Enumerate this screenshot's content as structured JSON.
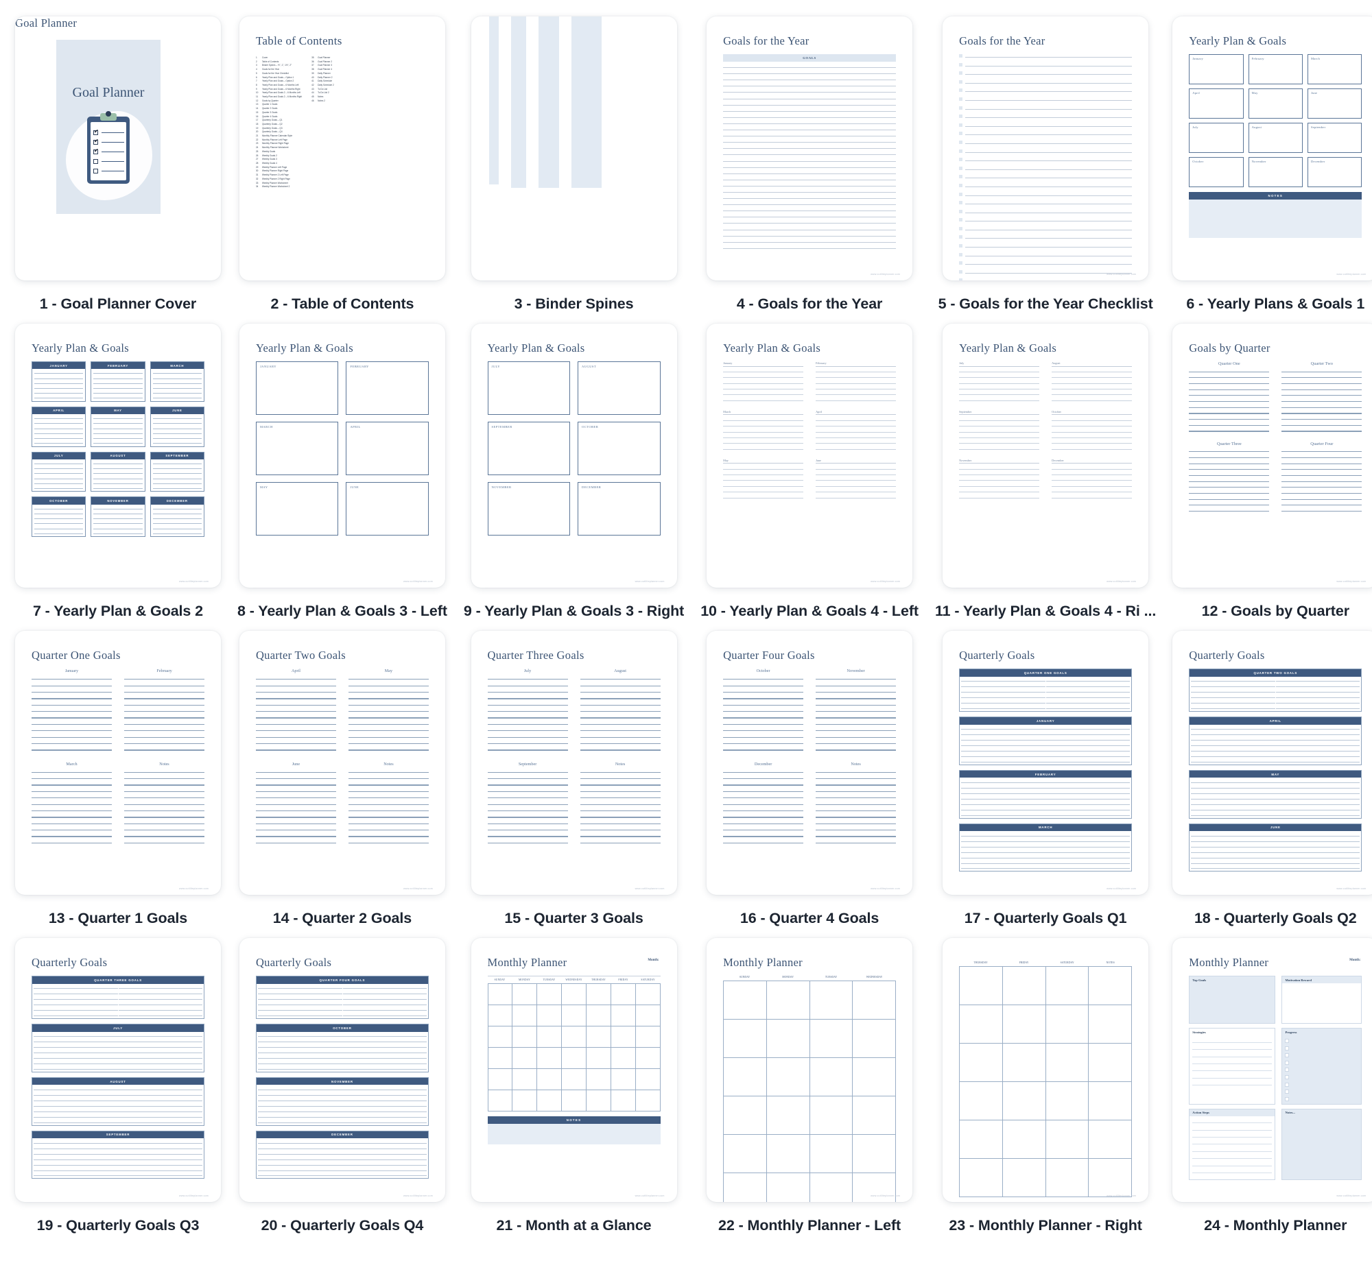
{
  "theme": {
    "accent_dark": "#3f5a80",
    "accent_light": "#dfe7f0",
    "title_color": "#3c5474",
    "page_bg": "#ffffff"
  },
  "cards": [
    {
      "n": 1,
      "caption": "1 - Goal Planner Cover",
      "type": "cover",
      "title": "Goal Planner"
    },
    {
      "n": 2,
      "caption": "2 - Table of Contents",
      "type": "toc",
      "title": "Table of Contents"
    },
    {
      "n": 3,
      "caption": "3 - Binder Spines",
      "type": "spines"
    },
    {
      "n": 4,
      "caption": "4 - Goals for the Year",
      "type": "lines",
      "title": "Goals for the Year",
      "header": "GOALS"
    },
    {
      "n": 5,
      "caption": "5 - Goals for the Year Checklist",
      "type": "checklist",
      "title": "Goals for the Year"
    },
    {
      "n": 6,
      "caption": "6 - Yearly Plans & Goals 1",
      "type": "monthbox",
      "title": "Yearly Plan & Goals",
      "notes": "NOTES"
    },
    {
      "n": 7,
      "caption": "7 - Yearly Plan & Goals 2",
      "type": "monthbar",
      "title": "Yearly Plan & Goals"
    },
    {
      "n": 8,
      "caption": "8 - Yearly Plan & Goals 3 - Left",
      "type": "bigbox",
      "title": "Yearly Plan & Goals",
      "months": [
        "JANUARY",
        "FEBRUARY",
        "MARCH",
        "APRIL",
        "MAY",
        "JUNE"
      ]
    },
    {
      "n": 9,
      "caption": "9 - Yearly Plan & Goals 3 - Right",
      "type": "bigbox",
      "title": "Yearly Plan & Goals",
      "months": [
        "JULY",
        "AUGUST",
        "SEPTEMBER",
        "OCTOBER",
        "NOVEMBER",
        "DECEMBER"
      ]
    },
    {
      "n": 10,
      "caption": "10 - Yearly Plan & Goals 4 - Left",
      "type": "labeled",
      "title": "Yearly Plan & Goals",
      "months": [
        "January",
        "February",
        "March",
        "April",
        "May",
        "June"
      ]
    },
    {
      "n": 11,
      "caption": "11 - Yearly Plan & Goals 4 - Ri  ...",
      "type": "labeled",
      "title": "Yearly Plan & Goals",
      "months": [
        "July",
        "August",
        "September",
        "October",
        "November",
        "December"
      ]
    },
    {
      "n": 12,
      "caption": "12 - Goals by Quarter",
      "type": "quarters",
      "title": "Goals by Quarter",
      "quarters": [
        "Quarter One",
        "Quarter Two",
        "Quarter Three",
        "Quarter Four"
      ]
    },
    {
      "n": 13,
      "caption": "13 - Quarter 1 Goals",
      "type": "qgoals",
      "title": "Quarter One Goals",
      "cells": [
        "January",
        "February",
        "March",
        "Notes"
      ]
    },
    {
      "n": 14,
      "caption": "14 - Quarter 2 Goals",
      "type": "qgoals",
      "title": "Quarter Two Goals",
      "cells": [
        "April",
        "May",
        "June",
        "Notes"
      ]
    },
    {
      "n": 15,
      "caption": "15 - Quarter 3 Goals",
      "type": "qgoals",
      "title": "Quarter Three Goals",
      "cells": [
        "July",
        "August",
        "September",
        "Notes"
      ]
    },
    {
      "n": 16,
      "caption": "16 - Quarter 4 Goals",
      "type": "qgoals",
      "title": "Quarter Four Goals",
      "cells": [
        "October",
        "November",
        "December",
        "Notes"
      ]
    },
    {
      "n": 17,
      "caption": "17 - Quarterly Goals Q1",
      "type": "banded",
      "title": "Quarterly Goals",
      "bands": [
        "QUARTER ONE GOALS",
        "JANUARY",
        "FEBRUARY",
        "MARCH"
      ]
    },
    {
      "n": 18,
      "caption": "18 - Quarterly Goals Q2",
      "type": "banded",
      "title": "Quarterly Goals",
      "bands": [
        "QUARTER TWO GOALS",
        "APRIL",
        "MAY",
        "JUNE"
      ]
    },
    {
      "n": 19,
      "caption": "19 - Quarterly Goals Q3",
      "type": "banded",
      "title": "Quarterly Goals",
      "bands": [
        "QUARTER THREE GOALS",
        "JULY",
        "AUGUST",
        "SEPTEMBER"
      ]
    },
    {
      "n": 20,
      "caption": "20 - Quarterly Goals Q4",
      "type": "banded",
      "title": "Quarterly Goals",
      "bands": [
        "QUARTER FOUR GOALS",
        "OCTOBER",
        "NOVEMBER",
        "DECEMBER"
      ]
    },
    {
      "n": 21,
      "caption": "21 - Month at a Glance",
      "type": "calendar",
      "title": "Monthly Planner",
      "month_label": "Month:",
      "notes": "NOTES",
      "dow": [
        "SUNDAY",
        "MONDAY",
        "TUESDAY",
        "WEDNESDAY",
        "THURSDAY",
        "FRIDAY",
        "SATURDAY"
      ]
    },
    {
      "n": 22,
      "caption": "22 - Monthly Planner - Left",
      "type": "halfcal",
      "title": "Monthly Planner",
      "dow": [
        "SUNDAY",
        "MONDAY",
        "TUESDAY",
        "WEDNESDAY"
      ]
    },
    {
      "n": 23,
      "caption": "23 - Monthly Planner - Right",
      "type": "halfcal",
      "title": "",
      "dow": [
        "THURSDAY",
        "FRIDAY",
        "SATURDAY",
        "NOTES"
      ]
    },
    {
      "n": 24,
      "caption": "24 - Monthly Planner",
      "type": "worksheet",
      "title": "Monthly Planner",
      "month_label": "Month:",
      "sections": {
        "top_goals": "Top Goals",
        "strategies": "Strategies",
        "action_steps": "Action Steps",
        "motivation": "Motivation Reward",
        "progress": "Progress",
        "notes": "Notes..."
      }
    }
  ],
  "toc": {
    "left": [
      {
        "n": "1",
        "t": "Cover"
      },
      {
        "n": "2",
        "t": "Table of Contents"
      },
      {
        "n": "3",
        "t": "Binder Spines – ½\", 1\", 1½\", 2\""
      },
      {
        "n": "4",
        "t": "Goals for the Year"
      },
      {
        "n": "5",
        "t": "Goals for the Year Checklist"
      },
      {
        "n": "6",
        "t": "Yearly Plan and Goals – Option 1"
      },
      {
        "n": "7",
        "t": "Yearly Plan and Goals – Option 2"
      },
      {
        "n": "8",
        "t": "Yearly Plan and Goals – 6 Months Left"
      },
      {
        "n": "9",
        "t": "Yearly Plan and Goals – 6 Months Right"
      },
      {
        "n": "10",
        "t": "Yearly Plan and Goals 2 – 6 Months Left"
      },
      {
        "n": "11",
        "t": "Yearly Plan and Goals 2 – 6 Months Right"
      },
      {
        "n": "12",
        "t": "Goals by Quarter"
      },
      {
        "n": "13",
        "t": "Quarter 1 Goals"
      },
      {
        "n": "14",
        "t": "Quarter 2 Goals"
      },
      {
        "n": "15",
        "t": "Quarter 3 Goals"
      },
      {
        "n": "16",
        "t": "Quarter 4 Goals"
      },
      {
        "n": "17",
        "t": "Quarterly Goals – Q1"
      },
      {
        "n": "18",
        "t": "Quarterly Goals – Q2"
      },
      {
        "n": "19",
        "t": "Quarterly Goals – Q3"
      },
      {
        "n": "20",
        "t": "Quarterly Goals – Q4"
      },
      {
        "n": "21",
        "t": "Monthly Planner Calendar Style"
      },
      {
        "n": "22",
        "t": "Monthly Planner Left Page"
      },
      {
        "n": "23",
        "t": "Monthly Planner Right Page"
      },
      {
        "n": "24",
        "t": "Monthly Planner Worksheet"
      },
      {
        "n": "25",
        "t": "Weekly Goals"
      },
      {
        "n": "26",
        "t": "Weekly Goals 2"
      },
      {
        "n": "27",
        "t": "Weekly Goals 3"
      },
      {
        "n": "28",
        "t": "Weekly Goals 4"
      },
      {
        "n": "29",
        "t": "Weekly Planner Left Page"
      },
      {
        "n": "30",
        "t": "Weekly Planner Right Page"
      },
      {
        "n": "31",
        "t": "Weekly Planner 2 Left Page"
      },
      {
        "n": "32",
        "t": "Weekly Planner 2 Right Page"
      },
      {
        "n": "33",
        "t": "Weekly Planner Worksheet"
      },
      {
        "n": "34",
        "t": "Weekly Planner Worksheet 2"
      }
    ],
    "right": [
      {
        "n": "35",
        "t": "Goal Planner"
      },
      {
        "n": "36",
        "t": "Goal Planner 2"
      },
      {
        "n": "37",
        "t": "Goal Planner 3"
      },
      {
        "n": "38",
        "t": "Goal Planner 4"
      },
      {
        "n": "39",
        "t": "Daily Planner"
      },
      {
        "n": "40",
        "t": "Daily Planner 2"
      },
      {
        "n": "41",
        "t": "Daily Schedule"
      },
      {
        "n": "42",
        "t": "Daily Schedule 2"
      },
      {
        "n": "43",
        "t": "To Do List"
      },
      {
        "n": "44",
        "t": "To Do List 2"
      },
      {
        "n": "45",
        "t": "Notes"
      },
      {
        "n": "46",
        "t": "Notes 2"
      }
    ]
  },
  "months_3col": [
    "January",
    "February",
    "March",
    "April",
    "May",
    "June",
    "July",
    "August",
    "September",
    "October",
    "November",
    "December"
  ],
  "months_3col_caps": [
    "JANUARY",
    "FEBRUARY",
    "MARCH",
    "APRIL",
    "MAY",
    "JUNE",
    "JULY",
    "AUGUST",
    "SEPTEMBER",
    "OCTOBER",
    "NOVEMBER",
    "DECEMBER"
  ],
  "watermark": "www.cutiliteplanner.com"
}
